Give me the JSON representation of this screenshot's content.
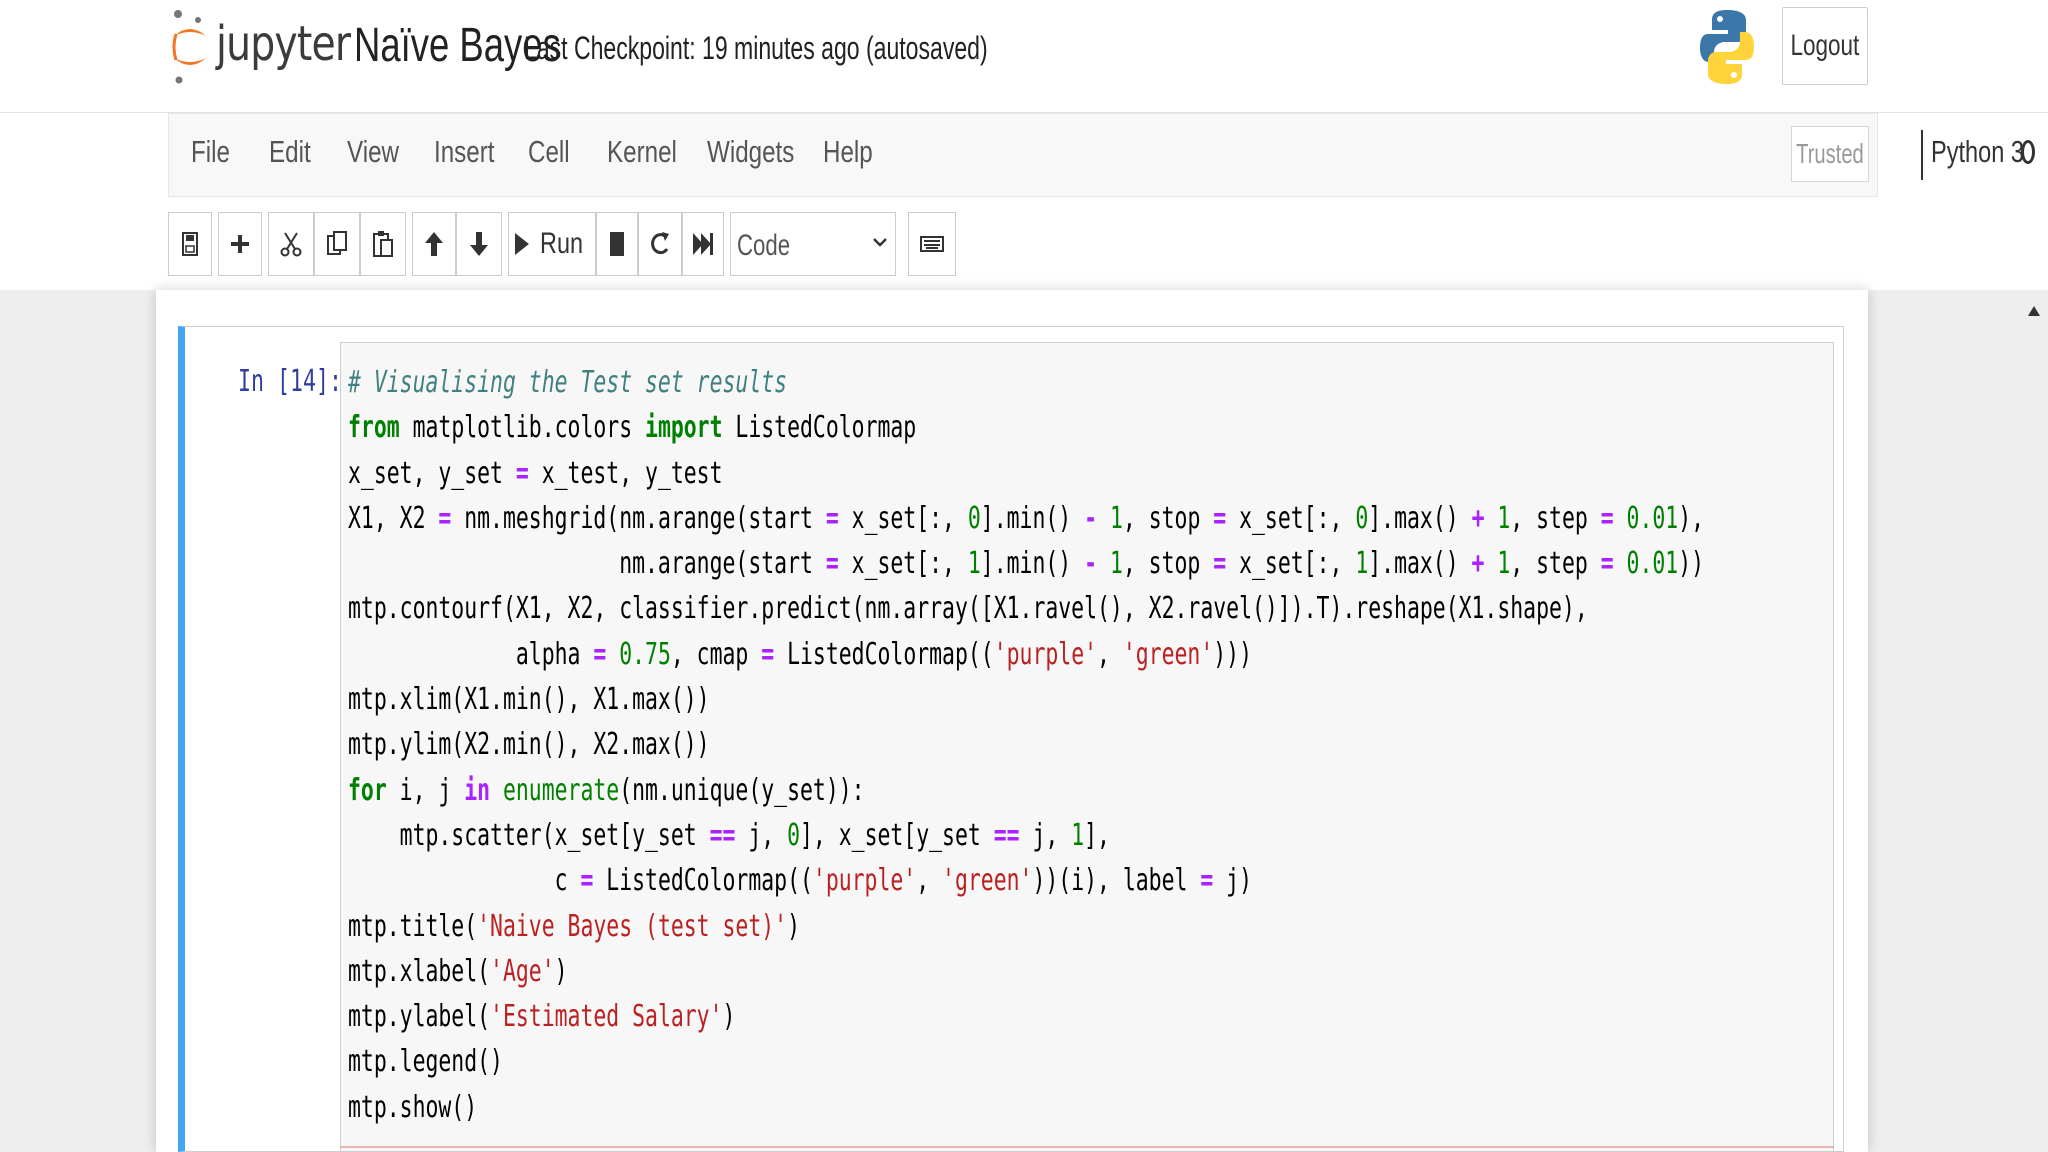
{
  "header": {
    "logo_text": "jupyter",
    "notebook_title": "Naïve Bayes",
    "checkpoint_text": "Last Checkpoint: 19 minutes ago  (autosaved)",
    "logout_label": "Logout"
  },
  "menubar": {
    "items": [
      {
        "label": "File"
      },
      {
        "label": "Edit"
      },
      {
        "label": "View"
      },
      {
        "label": "Insert"
      },
      {
        "label": "Cell"
      },
      {
        "label": "Kernel"
      },
      {
        "label": "Widgets"
      },
      {
        "label": "Help"
      }
    ],
    "trusted_label": "Trusted",
    "kernel_name": "Python 3"
  },
  "toolbar": {
    "buttons": [
      "save-icon",
      "plus-icon",
      "cut-icon",
      "copy-icon",
      "paste-icon",
      "arrow-up-icon",
      "arrow-down-icon",
      "run-icon",
      "stop-icon",
      "restart-icon",
      "fast-forward-icon",
      "keyboard-icon"
    ],
    "run_label": "Run",
    "cell_type": "Code",
    "cell_type_options": [
      "Code"
    ]
  },
  "cell": {
    "prompt": "In [14]:",
    "code_lines": [
      [
        {
          "t": "# Visualising the Test set results",
          "c": "cm"
        }
      ],
      [
        {
          "t": "from",
          "c": "kw"
        },
        {
          "t": " matplotlib.colors "
        },
        {
          "t": "import",
          "c": "kw"
        },
        {
          "t": " ListedColormap"
        }
      ],
      [
        {
          "t": "x_set, y_set "
        },
        {
          "t": "=",
          "c": "op"
        },
        {
          "t": " x_test, y_test"
        }
      ],
      [
        {
          "t": "X1, X2 "
        },
        {
          "t": "=",
          "c": "op"
        },
        {
          "t": " nm.meshgrid(nm.arange(start "
        },
        {
          "t": "=",
          "c": "op"
        },
        {
          "t": " x_set[:, "
        },
        {
          "t": "0",
          "c": "nm"
        },
        {
          "t": "].min() "
        },
        {
          "t": "-",
          "c": "op"
        },
        {
          "t": " "
        },
        {
          "t": "1",
          "c": "nm"
        },
        {
          "t": ", stop "
        },
        {
          "t": "=",
          "c": "op"
        },
        {
          "t": " x_set[:, "
        },
        {
          "t": "0",
          "c": "nm"
        },
        {
          "t": "].max() "
        },
        {
          "t": "+",
          "c": "op"
        },
        {
          "t": " "
        },
        {
          "t": "1",
          "c": "nm"
        },
        {
          "t": ", step "
        },
        {
          "t": "=",
          "c": "op"
        },
        {
          "t": " "
        },
        {
          "t": "0.01",
          "c": "nm"
        },
        {
          "t": "),"
        }
      ],
      [
        {
          "t": "                     nm.arange(start "
        },
        {
          "t": "=",
          "c": "op"
        },
        {
          "t": " x_set[:, "
        },
        {
          "t": "1",
          "c": "nm"
        },
        {
          "t": "].min() "
        },
        {
          "t": "-",
          "c": "op"
        },
        {
          "t": " "
        },
        {
          "t": "1",
          "c": "nm"
        },
        {
          "t": ", stop "
        },
        {
          "t": "=",
          "c": "op"
        },
        {
          "t": " x_set[:, "
        },
        {
          "t": "1",
          "c": "nm"
        },
        {
          "t": "].max() "
        },
        {
          "t": "+",
          "c": "op"
        },
        {
          "t": " "
        },
        {
          "t": "1",
          "c": "nm"
        },
        {
          "t": ", step "
        },
        {
          "t": "=",
          "c": "op"
        },
        {
          "t": " "
        },
        {
          "t": "0.01",
          "c": "nm"
        },
        {
          "t": "))"
        }
      ],
      [
        {
          "t": "mtp.contourf(X1, X2, classifier.predict(nm.array([X1.ravel(), X2.ravel()]).T).reshape(X1.shape),"
        }
      ],
      [
        {
          "t": "             alpha "
        },
        {
          "t": "=",
          "c": "op"
        },
        {
          "t": " "
        },
        {
          "t": "0.75",
          "c": "nm"
        },
        {
          "t": ", cmap "
        },
        {
          "t": "=",
          "c": "op"
        },
        {
          "t": " ListedColormap(("
        },
        {
          "t": "'purple'",
          "c": "st"
        },
        {
          "t": ", "
        },
        {
          "t": "'green'",
          "c": "st"
        },
        {
          "t": ")))"
        }
      ],
      [
        {
          "t": "mtp.xlim(X1.min(), X1.max())"
        }
      ],
      [
        {
          "t": "mtp.ylim(X2.min(), X2.max())"
        }
      ],
      [
        {
          "t": "for",
          "c": "kw"
        },
        {
          "t": " i, j "
        },
        {
          "t": "in",
          "c": "op"
        },
        {
          "t": " "
        },
        {
          "t": "enumerate",
          "c": "bi"
        },
        {
          "t": "(nm.unique(y_set)):"
        }
      ],
      [
        {
          "t": "    mtp.scatter(x_set[y_set "
        },
        {
          "t": "==",
          "c": "op"
        },
        {
          "t": " j, "
        },
        {
          "t": "0",
          "c": "nm"
        },
        {
          "t": "], x_set[y_set "
        },
        {
          "t": "==",
          "c": "op"
        },
        {
          "t": " j, "
        },
        {
          "t": "1",
          "c": "nm"
        },
        {
          "t": "],"
        }
      ],
      [
        {
          "t": "                c "
        },
        {
          "t": "=",
          "c": "op"
        },
        {
          "t": " ListedColormap(("
        },
        {
          "t": "'purple'",
          "c": "st"
        },
        {
          "t": ", "
        },
        {
          "t": "'green'",
          "c": "st"
        },
        {
          "t": "))(i), label "
        },
        {
          "t": "=",
          "c": "op"
        },
        {
          "t": " j)"
        }
      ],
      [
        {
          "t": "mtp.title("
        },
        {
          "t": "'Naive Bayes (test set)'",
          "c": "st"
        },
        {
          "t": ")"
        }
      ],
      [
        {
          "t": "mtp.xlabel("
        },
        {
          "t": "'Age'",
          "c": "st"
        },
        {
          "t": ")"
        }
      ],
      [
        {
          "t": "mtp.ylabel("
        },
        {
          "t": "'Estimated Salary'",
          "c": "st"
        },
        {
          "t": ")"
        }
      ],
      [
        {
          "t": "mtp.legend()"
        }
      ],
      [
        {
          "t": "mtp.show()"
        }
      ]
    ]
  },
  "colors": {
    "cell_selected_border": "#42a5f5",
    "prompt": "#303f9f",
    "keyword": "#008000",
    "operator": "#aa22ff",
    "string": "#ba2121",
    "comment": "#408080"
  }
}
